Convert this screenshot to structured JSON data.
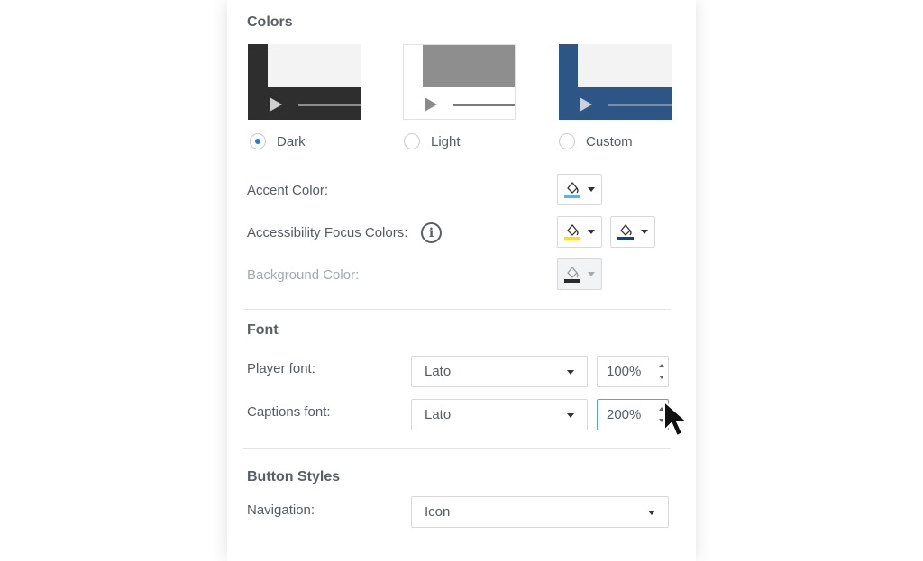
{
  "colors": {
    "title": "Colors",
    "themes": [
      {
        "name": "Dark",
        "selected": true
      },
      {
        "name": "Light",
        "selected": false
      },
      {
        "name": "Custom",
        "selected": false
      }
    ],
    "accent_label": "Accent Color:",
    "focus_label": "Accessibility Focus Colors:",
    "info_glyph": "i",
    "background_label": "Background Color:",
    "swatches": {
      "accent": "#5ab4e0",
      "focus_primary": "#f5e31a",
      "focus_secondary": "#1f3d78",
      "background": "#2b2b2b",
      "dark_theme": "#2e2e2e",
      "custom_theme": "#2d5687",
      "radio_selected": "#2b7bd4"
    }
  },
  "font": {
    "title": "Font",
    "player_label": "Player font:",
    "player_font": "Lato",
    "player_size": "100%",
    "captions_label": "Captions font:",
    "captions_font": "Lato",
    "captions_size": "200%"
  },
  "buttons": {
    "title": "Button Styles",
    "navigation_label": "Navigation:",
    "navigation_value": "Icon"
  }
}
